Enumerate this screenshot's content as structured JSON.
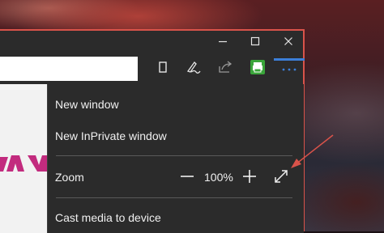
{
  "titlebar": {
    "minimize_icon": "minimize-icon",
    "maximize_icon": "maximize-icon",
    "close_icon": "close-icon"
  },
  "toolbar": {
    "address_value": "",
    "icons": [
      "reading-view-icon",
      "web-note-icon",
      "share-icon",
      "print-extension-icon",
      "more-actions-icon"
    ]
  },
  "menu": {
    "new_window": "New window",
    "new_inprivate_window": "New InPrivate window",
    "zoom_label": "Zoom",
    "zoom_value": "100%",
    "cast_media": "Cast media to device"
  },
  "colors": {
    "window_border": "#d9534a",
    "menu_bg": "#2b2b2b",
    "accent": "#3c7fd8",
    "print_icon": "#3aa53a",
    "annotation_arrow": "#d9534a"
  }
}
